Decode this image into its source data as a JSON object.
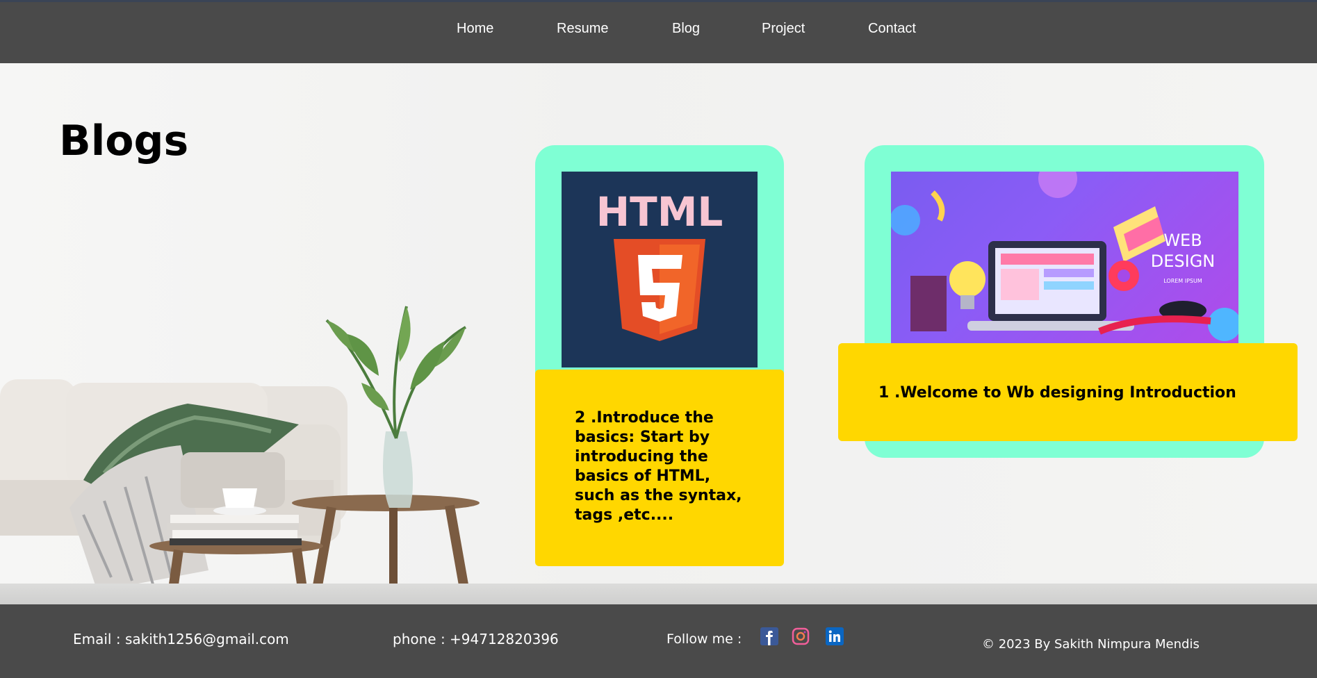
{
  "nav": {
    "items": [
      "Home",
      "Resume",
      "Blog",
      "Project",
      "Contact"
    ]
  },
  "page": {
    "title": "Blogs"
  },
  "cards": [
    {
      "image_alt": "HTML5 logo",
      "image_text": "HTML",
      "shield_text": "5",
      "text": "2 .Introduce the basics: Start by introducing the basics of HTML, such as the syntax, tags ,etc...."
    },
    {
      "image_alt": "Web design illustration",
      "image_text_1": "WEB",
      "image_text_2": "DESIGN",
      "image_text_3": "LOREM IPSUM",
      "text": "1 .Welcome to Wb designing Introduction"
    }
  ],
  "footer": {
    "email": "Email : sakith1256@gmail.com",
    "phone": "phone : +94712820396",
    "follow": "Follow me :",
    "copyright": "© 2023 By Sakith Nimpura Mendis",
    "social_icons": [
      "facebook-icon",
      "instagram-icon",
      "linkedin-icon"
    ]
  },
  "colors": {
    "header_bg": "#4a4a4a",
    "card_bg": "#7fffd4",
    "card_text_bg": "#ffd700",
    "html_bg": "#1c3558",
    "html_orange": "#e44d26"
  }
}
